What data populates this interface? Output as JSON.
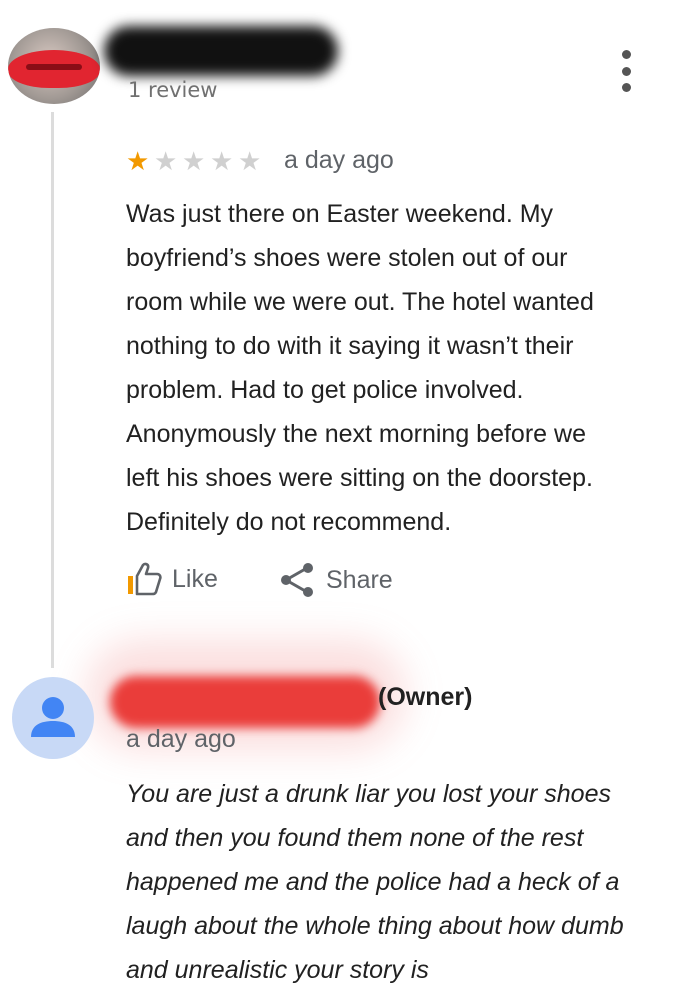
{
  "review": {
    "review_count": "1 review",
    "rating": 1,
    "rating_max": 5,
    "star_glyph": "★",
    "date": "a day ago",
    "lines": [
      "Was just there on Easter weekend. My",
      "boyfriend’s shoes were stolen out of our",
      "room while we were out. The hotel wanted",
      "nothing to do with it saying it wasn’t their",
      "problem. Had to get police involved.",
      "Anonymously the next morning before we",
      "left his shoes were sitting on the doorstep.",
      "Definitely do not recommend."
    ],
    "like_label": "Like",
    "share_label": "Share"
  },
  "reply": {
    "owner_badge": "(Owner)",
    "date": "a day ago",
    "lines": [
      "You are just a drunk liar you lost your shoes",
      "and then you found them none of the rest",
      "happened me and the police had a heck of a",
      "laugh about the whole thing about how dumb",
      "and unrealistic your story is"
    ]
  },
  "icons": {
    "more": "more-vert-icon",
    "like": "thumb-up-icon",
    "share": "share-icon",
    "owner_avatar": "person-icon"
  },
  "colors": {
    "star_on": "#f29900",
    "star_off": "#d0d0d0",
    "owner_avatar_bg": "#c8d9f6",
    "owner_avatar_fg": "#4285f4",
    "redaction_red": "#ea3d3a"
  }
}
